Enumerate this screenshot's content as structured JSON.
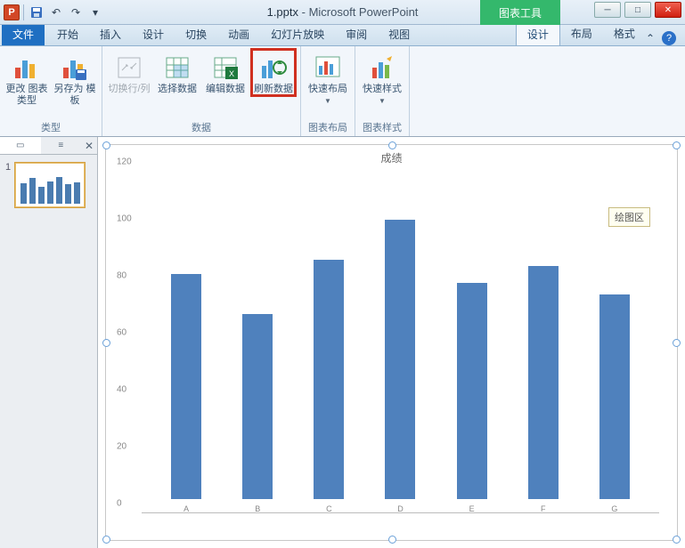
{
  "app": {
    "filename": "1.pptx",
    "title_suffix": "Microsoft PowerPoint",
    "context_tool_label": "图表工具"
  },
  "qat": {
    "save": "保存",
    "undo": "撤销",
    "redo": "重做"
  },
  "window": {
    "min": "─",
    "max": "□",
    "close": "✕"
  },
  "tabs": {
    "file": "文件",
    "items": [
      "开始",
      "插入",
      "设计",
      "切换",
      "动画",
      "幻灯片放映",
      "审阅",
      "视图"
    ],
    "context": [
      "设计",
      "布局",
      "格式"
    ],
    "active_context_index": 0
  },
  "ribbon": {
    "group_type": {
      "label": "类型",
      "change_chart_type": "更改\n图表类型",
      "save_as_template": "另存为\n模板"
    },
    "group_data": {
      "label": "数据",
      "switch_rc": "切换行/列",
      "select_data": "选择数据",
      "edit_data": "编辑数据",
      "refresh_data": "刷新数据"
    },
    "group_layout": {
      "label": "图表布局",
      "quick_layout": "快速布局"
    },
    "group_style": {
      "label": "图表样式",
      "quick_style": "快速样式"
    }
  },
  "slidepanel": {
    "tab_slides_icon": "▭",
    "tab_outline_icon": "≡",
    "close": "✕",
    "slide_number": "1"
  },
  "chart_data": {
    "type": "bar",
    "title": "成绩",
    "categories": [
      "A",
      "B",
      "C",
      "D",
      "E",
      "F",
      "G"
    ],
    "values": [
      79,
      65,
      84,
      98,
      76,
      82,
      72
    ],
    "ylim": [
      0,
      120
    ],
    "yticks": [
      0,
      20,
      40,
      60,
      80,
      100,
      120
    ],
    "plot_area_tooltip": "绘图区"
  },
  "colors": {
    "bar": "#4f81bd",
    "accent": "#d24726",
    "context": "#34b86c"
  }
}
